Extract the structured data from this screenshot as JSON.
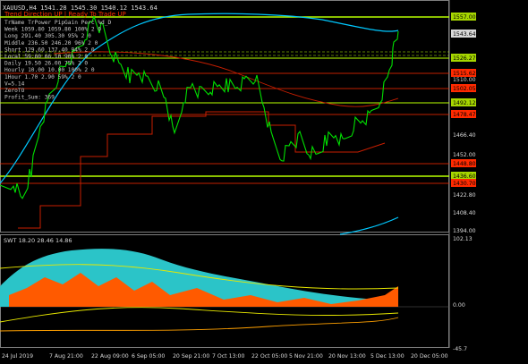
{
  "header": {
    "symbol_line": "XAUUSD,H4  1541.28 1545.30 1540.12 1543.64",
    "trend_label": "Trend Direction   UP   |   Ready To Trade UP"
  },
  "overlay": {
    "rows": [
      "TrName   TrPower    PipGain    Perc   %d_D",
      "Week    1059.80     1059.80    100%   2   0",
      "Long    291.40      305.30     95%    2   0",
      "Middle  236.50      246.20     96%    2   0",
      "Short   129.60      137.40     94%    2   0",
      "Local   59.60       66.10      90%    2   0",
      "Daily   19.50       26.00      75%    2   0",
      "Hourly  10.00       10.00      100%   2   0",
      "1Hour   1.70        2.90       59%    2   0",
      "V=5.14",
      "ZeroTO",
      "Profit_Sum: 369"
    ]
  },
  "main_panel": {
    "price_scale": [
      {
        "label": "1568.00",
        "kind": "tick"
      },
      {
        "label": "1557.00",
        "kind": "box",
        "color": "#a6d600"
      },
      {
        "label": "1543.64",
        "kind": "box",
        "color": "#d9d9d9"
      },
      {
        "label": "1526.27",
        "kind": "box",
        "color": "#a6d600"
      },
      {
        "label": "1515.62",
        "kind": "box",
        "color": "#ff2a00"
      },
      {
        "label": "1510.00",
        "kind": "tick"
      },
      {
        "label": "1502.05",
        "kind": "box",
        "color": "#ff2a00"
      },
      {
        "label": "1492.12",
        "kind": "box",
        "color": "#a6d600"
      },
      {
        "label": "1480.00",
        "kind": "tick"
      },
      {
        "label": "1478.47",
        "kind": "box",
        "color": "#ff2a00"
      },
      {
        "label": "1466.40",
        "kind": "tick"
      },
      {
        "label": "1452.00",
        "kind": "tick"
      },
      {
        "label": "1448.80",
        "kind": "box",
        "color": "#ff2a00"
      },
      {
        "label": "1436.60",
        "kind": "box",
        "color": "#a6d600"
      },
      {
        "label": "1430.70",
        "kind": "box",
        "color": "#ff2a00"
      },
      {
        "label": "1422.80",
        "kind": "tick"
      },
      {
        "label": "1408.40",
        "kind": "tick"
      },
      {
        "label": "1394.00",
        "kind": "tick"
      }
    ]
  },
  "sub_panel": {
    "title": "SWT 18.20 28.46 14.86",
    "scale": [
      {
        "label": "102.13"
      },
      {
        "label": "0.00"
      },
      {
        "label": "-45.7"
      }
    ]
  },
  "time_axis": [
    "24 Jul 2019",
    "7 Aug 21:00",
    "22 Aug 09:00",
    "6 Sep 05:00",
    "20 Sep 21:00",
    "7 Oct 13:00",
    "22 Oct 05:00",
    "5 Nov 21:00",
    "20 Nov 13:00",
    "5 Dec 13:00",
    "20 Dec 05:00"
  ],
  "colors": {
    "price_line": "#00e000",
    "ma_blue": "#00c8ff",
    "ma_red": "#c81e00",
    "support_line": "#b7ff00",
    "resist_line": "#ff2a00",
    "cyan_fill": "#2bc4c8",
    "orange_fill": "#ff5a00",
    "yellow_line": "#e8e800"
  }
}
